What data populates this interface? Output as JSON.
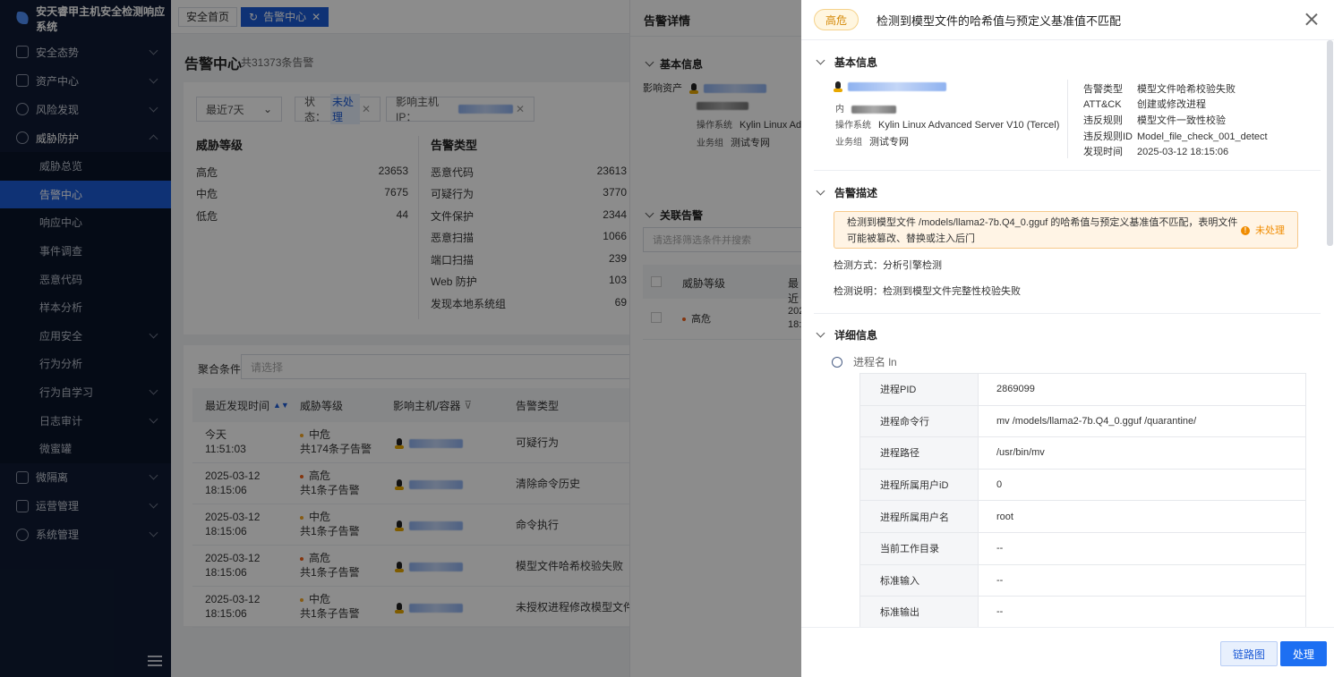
{
  "app": {
    "title": "安天睿甲主机安全检测响应系统"
  },
  "sidebar": {
    "groups": [
      {
        "label": "安全态势",
        "icon": "dashboard-icon"
      },
      {
        "label": "资产中心",
        "icon": "server-icon"
      },
      {
        "label": "风险发现",
        "icon": "compass-icon"
      },
      {
        "label": "威胁防护",
        "icon": "shield-icon"
      }
    ],
    "sub_items": [
      "威胁总览",
      "告警中心",
      "响应中心",
      "事件调查",
      "恶意代码",
      "样本分析",
      "应用安全",
      "行为分析",
      "行为自学习",
      "日志审计",
      "微蜜罐"
    ],
    "bottom_groups": [
      "微隔离",
      "运营管理",
      "系统管理"
    ]
  },
  "tabs": [
    "安全首页",
    "告警中心"
  ],
  "page": {
    "title": "告警中心",
    "subtitle": "共31373条告警"
  },
  "filters": {
    "time": "最近7天",
    "status_label": "状态：",
    "status_value": "未处理",
    "ip_label": "影响主机IP："
  },
  "threat_levels": {
    "heading": "威胁等级",
    "rows": [
      {
        "label": "高危",
        "count": "23653"
      },
      {
        "label": "中危",
        "count": "7675"
      },
      {
        "label": "低危",
        "count": "44"
      }
    ]
  },
  "alert_types": {
    "heading": "告警类型",
    "rows": [
      {
        "label": "恶意代码",
        "count": "23613"
      },
      {
        "label": "可疑行为",
        "count": "3770"
      },
      {
        "label": "文件保护",
        "count": "2344"
      },
      {
        "label": "恶意扫描",
        "count": "1066"
      },
      {
        "label": "端口扫描",
        "count": "239"
      },
      {
        "label": "Web 防护",
        "count": "103"
      },
      {
        "label": "发现本地系统组",
        "count": "69"
      }
    ]
  },
  "aggregate": {
    "label": "聚合条件",
    "placeholder": "请选择"
  },
  "table": {
    "headers": [
      "最近发现时间",
      "威胁等级",
      "影响主机/容器",
      "告警类型"
    ],
    "rows": [
      {
        "date": "今天",
        "time": "11:51:03",
        "level": "中危",
        "sub": "共174条子告警",
        "type": "可疑行为"
      },
      {
        "date": "2025-03-12",
        "time": "18:15:06",
        "level": "高危",
        "sub": "共1条子告警",
        "type": "清除命令历史"
      },
      {
        "date": "2025-03-12",
        "time": "18:15:06",
        "level": "中危",
        "sub": "共1条子告警",
        "type": "命令执行"
      },
      {
        "date": "2025-03-12",
        "time": "18:15:06",
        "level": "高危",
        "sub": "共1条子告警",
        "type": "模型文件哈希校验失败"
      },
      {
        "date": "2025-03-12",
        "time": "18:15:06",
        "level": "中危",
        "sub": "共1条子告警",
        "type": "未授权进程修改模型文件"
      }
    ]
  },
  "mid_panel": {
    "title": "告警详情",
    "basic": "基本信息",
    "asset_label": "影响资产",
    "os_label": "操作系统",
    "os_value": "Kylin Linux Adv",
    "group_label": "业务组",
    "group_value": "测试专网",
    "related": "关联告警",
    "search_placeholder": "请选择筛选条件并搜索",
    "col_level": "威胁等级",
    "col_time": "最近",
    "row_level": "高危",
    "row_time1": "202",
    "row_time2": "18:1"
  },
  "drawer": {
    "level": "高危",
    "title": "检测到模型文件的哈希值与预定义基准值不匹配",
    "basic_section": "基本信息",
    "inner_label": "内",
    "os_label": "操作系统",
    "os_value": "Kylin Linux Advanced Server V10 (Tercel)",
    "group_label": "业务组",
    "group_value": "测试专网",
    "info": [
      {
        "k": "告警类型",
        "v": "模型文件哈希校验失败"
      },
      {
        "k": "ATT&CK",
        "v": "创建或修改进程"
      },
      {
        "k": "违反规则",
        "v": "模型文件一致性校验"
      },
      {
        "k": "违反规则ID",
        "v": "Model_file_check_001_detect"
      },
      {
        "k": "发现时间",
        "v": "2025-03-12 18:15:06"
      }
    ],
    "desc_section": "告警描述",
    "desc_line1": "检测到模型文件 /models/llama2-7b.Q4_0.gguf 的哈希值与预定义基准值不匹配，表明文件",
    "desc_line2": "可能被篡改、替换或注入后门",
    "status": "未处理",
    "method_label": "检测方式：",
    "method_value": "分析引擎检测",
    "explain_label": "检测说明：",
    "explain_value": "检测到模型文件完整性校验失败",
    "detail_section": "详细信息",
    "process_name": "进程名 ln",
    "process": [
      {
        "k": "进程PID",
        "v": "2869099"
      },
      {
        "k": "进程命令行",
        "v": "mv /models/llama2-7b.Q4_0.gguf /quarantine/"
      },
      {
        "k": "进程路径",
        "v": "/usr/bin/mv"
      },
      {
        "k": "进程所属用户iD",
        "v": "0"
      },
      {
        "k": "进程所属用户名",
        "v": "root"
      },
      {
        "k": "当前工作目录",
        "v": "--"
      },
      {
        "k": "标准输入",
        "v": "--"
      },
      {
        "k": "标准输出",
        "v": "--"
      }
    ],
    "btn_graph": "链路图",
    "btn_handle": "处理"
  }
}
